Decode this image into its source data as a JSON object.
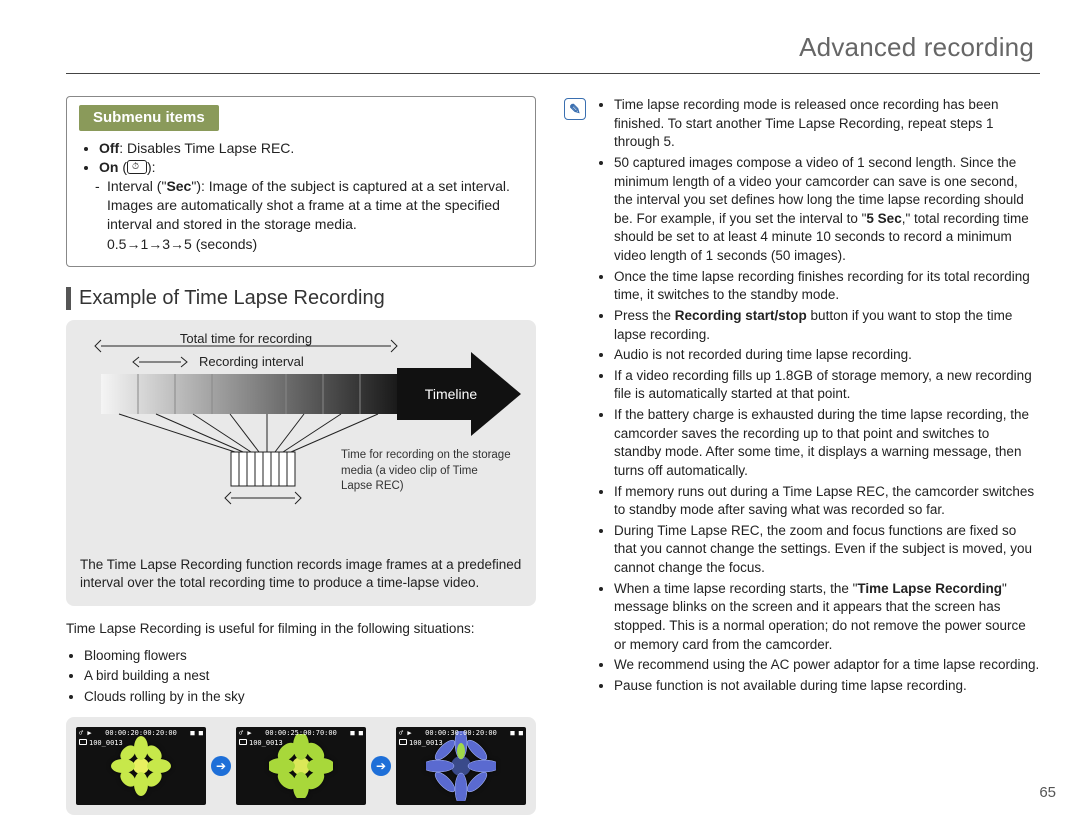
{
  "header": {
    "title": "Advanced recording"
  },
  "page_number": "65",
  "submenu": {
    "title": "Submenu items",
    "off_label": "Off",
    "off_desc": ": Disables Time Lapse REC.",
    "on_label": "On",
    "on_suffix_open": " (",
    "on_suffix_close": "):",
    "interval_label": "Interval (\"",
    "sec_bold": "Sec",
    "interval_desc_rest": "\"): Image of the subject is captured at a set interval. Images are automatically shot a frame at a time at the specified interval and stored in the storage media.",
    "interval_values": "0.5→1→3→5 (seconds)"
  },
  "section_heading": "Example of Time Lapse Recording",
  "diagram": {
    "total_label": "Total time for recording",
    "interval_label": "Recording interval",
    "timeline_label": "Timeline",
    "caption": "Time for recording on the storage media (a video clip of Time Lapse REC)",
    "para": "The Time Lapse Recording function records image frames at a predefined interval over the total recording time to produce a time-lapse video."
  },
  "situations_intro": "Time Lapse Recording is useful for filming in the following situations:",
  "situations": [
    "Blooming flowers",
    "A bird building a nest",
    "Clouds rolling by in the sky"
  ],
  "thumbs": {
    "time1": "00:00:20:00:20:00",
    "time2": "00:00:25:00:70:00",
    "time3": "00:00:30:00:20:00",
    "line2": "100_0013",
    "rec_left": "♂ ▶",
    "rec_right": "■ ■"
  },
  "notes": [
    {
      "t": "Time lapse recording mode is released once recording has been finished. To start another Time Lapse Recording, repeat steps 1 through 5."
    },
    {
      "pre": "50 captured images compose a video of 1 second length. Since the minimum length of a video your camcorder can save is one second, the interval you set defines how long the time lapse recording should be. For example, if you set the interval to \"",
      "bold": "5 Sec",
      "post": ",\" total recording time should be set to at least 4 minute 10 seconds to record a minimum video length of 1 seconds (50 images)."
    },
    {
      "t": "Once the time lapse recording finishes recording for its total recording time, it switches to the standby mode."
    },
    {
      "pre": "Press the ",
      "bold": "Recording start/stop",
      "post": " button if you want to stop the time lapse recording."
    },
    {
      "t": "Audio is not recorded during time lapse recording."
    },
    {
      "t": "If a video recording fills up 1.8GB of storage memory, a new recording file is automatically started at that point."
    },
    {
      "t": "If the battery charge is exhausted during the time lapse recording, the camcorder saves the recording up to that point and switches to standby mode. After some time, it displays a warning message, then turns off automatically."
    },
    {
      "t": "If memory runs out during a Time Lapse REC, the camcorder switches to standby mode after saving what was recorded so far."
    },
    {
      "t": "During Time Lapse REC, the zoom and focus functions are fixed so that you cannot change the settings. Even if the subject is moved, you cannot change the focus."
    },
    {
      "pre": "When a time lapse recording starts, the \"",
      "bold": "Time Lapse Recording",
      "post": "\" message blinks on the screen and it appears that the screen has stopped. This is a normal operation; do not remove the power source or memory card from the camcorder."
    },
    {
      "t": "We recommend using the AC power adaptor for a time lapse recording."
    },
    {
      "t": "Pause function is not available during time lapse recording."
    }
  ]
}
